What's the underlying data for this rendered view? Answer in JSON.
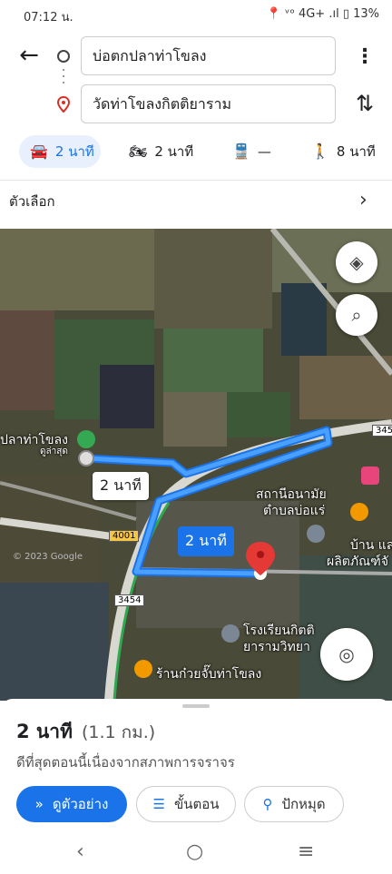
{
  "status_bar": {
    "time": "07:12 น.",
    "right": "📍 ᵛᵒ 4G+ .ıl ▯ 13%"
  },
  "search": {
    "origin": "บ่อตกปลาท่าโขลง",
    "destination": "วัดท่าโขลงกิตติยาราม"
  },
  "modes": [
    {
      "icon": "car-icon",
      "label": "2 นาที"
    },
    {
      "icon": "motorbike-icon",
      "label": "2 นาที"
    },
    {
      "icon": "train-icon",
      "label": "—"
    },
    {
      "icon": "walk-icon",
      "label": "8 นาที"
    }
  ],
  "options_label": "ตัวเลือก",
  "map": {
    "origin_label": "ปลาท่าโขลง",
    "origin_sub": "ดูล่าสุด",
    "route_time_alt": "2 นาที",
    "route_time_main": "2 นาที",
    "road_4001": "4001",
    "road_3454a": "3454",
    "road_3454b": "3454",
    "poi_1": "สถานีอนามัย",
    "poi_1b": "ตำบลบ่อแร่",
    "poi_2": "บ้าน แล",
    "poi_2b": "ผลิตภัณฑ์จั",
    "poi_3": "โรงเรียนกิตติ",
    "poi_3b": "ยารามวิทยา",
    "poi_4": "ร้านก๋วยจั๊บท่าโขลง",
    "copyright": "© 2023 Google"
  },
  "sheet": {
    "duration": "2 นาที",
    "distance": "(1.1 กม.)",
    "subtitle": "ดีที่สุดตอนนี้เนื่องจากสภาพการจราจร",
    "preview": "ดูตัวอย่าง",
    "steps": "ขั้นตอน",
    "pin": "ปักหมุด"
  },
  "colors": {
    "accent": "#1a73e8",
    "route": "#2b8cf0",
    "pin": "#e53935"
  }
}
